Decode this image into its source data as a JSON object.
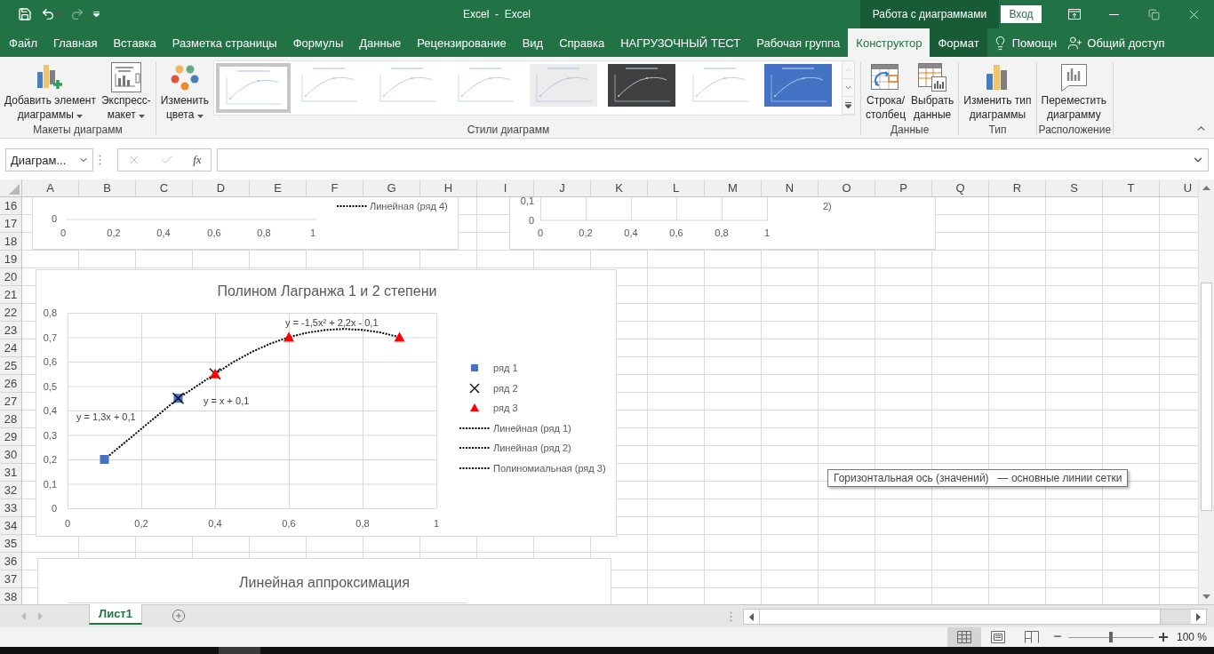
{
  "title_bar": {
    "title": "Excel  -  Excel",
    "context_label": "Работа с диаграммами",
    "sign_in": "Вход"
  },
  "tabs": [
    {
      "label": "Файл",
      "kind": "normal",
      "selected": false
    },
    {
      "label": "Главная",
      "kind": "normal",
      "selected": false
    },
    {
      "label": "Вставка",
      "kind": "normal",
      "selected": false
    },
    {
      "label": "Разметка страницы",
      "kind": "normal",
      "selected": false
    },
    {
      "label": "Формулы",
      "kind": "normal",
      "selected": false
    },
    {
      "label": "Данные",
      "kind": "normal",
      "selected": false
    },
    {
      "label": "Рецензирование",
      "kind": "normal",
      "selected": false
    },
    {
      "label": "Вид",
      "kind": "normal",
      "selected": false
    },
    {
      "label": "Справка",
      "kind": "normal",
      "selected": false
    },
    {
      "label": "НАГРУЗОЧНЫЙ ТЕСТ",
      "kind": "normal",
      "selected": false
    },
    {
      "label": "Рабочая группа",
      "kind": "normal",
      "selected": false
    },
    {
      "label": "Конструктор",
      "kind": "context",
      "selected": true
    },
    {
      "label": "Формат",
      "kind": "context",
      "selected": false
    }
  ],
  "tell_me": "Помощн",
  "share": "Общий доступ",
  "ribbon": {
    "groups": [
      {
        "label": "Макеты диаграмм",
        "items": [
          {
            "kind": "button",
            "lines": [
              "Добавить элемент",
              "диаграммы"
            ],
            "menu": true
          },
          {
            "kind": "button",
            "lines": [
              "Экспресс-",
              "макет"
            ],
            "menu": true
          }
        ]
      },
      {
        "label": "Стили диаграмм",
        "items": [
          {
            "kind": "button",
            "lines": [
              "Изменить",
              "цвета"
            ],
            "menu": true
          },
          {
            "kind": "gallery",
            "styles": [
              {
                "selected": true
              },
              {
                "selected": false
              },
              {
                "selected": false
              },
              {
                "selected": false
              },
              {
                "selected": false
              },
              {
                "selected": false
              },
              {
                "selected": false
              },
              {
                "selected": false
              }
            ]
          }
        ]
      },
      {
        "label": "Данные",
        "items": [
          {
            "kind": "button",
            "lines": [
              "Строка/",
              "столбец"
            ],
            "menu": false
          },
          {
            "kind": "button",
            "lines": [
              "Выбрать",
              "данные"
            ],
            "menu": false
          }
        ]
      },
      {
        "label": "Тип",
        "items": [
          {
            "kind": "button",
            "lines": [
              "Изменить тип",
              "диаграммы"
            ],
            "menu": false
          }
        ]
      },
      {
        "label": "Расположение",
        "items": [
          {
            "kind": "button",
            "lines": [
              "Переместить",
              "диаграмму"
            ],
            "menu": false
          }
        ]
      }
    ]
  },
  "formula_bar": {
    "name_box": "Диаграм...",
    "function_label": "fx"
  },
  "columns": [
    "A",
    "B",
    "C",
    "D",
    "E",
    "F",
    "G",
    "H",
    "I",
    "J",
    "K",
    "L",
    "M",
    "N",
    "O",
    "P",
    "Q",
    "R",
    "S",
    "T",
    "U"
  ],
  "rows": [
    "16",
    "17",
    "18",
    "19",
    "20",
    "21",
    "22",
    "23",
    "24",
    "25",
    "26",
    "27",
    "28",
    "29",
    "30",
    "31",
    "32",
    "33",
    "34",
    "35",
    "36",
    "37",
    "38"
  ],
  "upper_charts": [
    {
      "y_labels": [
        "0"
      ],
      "x_labels": [
        "0",
        "0,2",
        "0,4",
        "0,6",
        "0,8",
        "1"
      ],
      "legend": [
        {
          "text": "Линейная (ряд 4)",
          "line": true
        }
      ]
    },
    {
      "y_labels": [
        "0,1",
        "0"
      ],
      "x_labels": [
        "0",
        "0,2",
        "0,4",
        "0,6",
        "0,8",
        "1"
      ],
      "legend": [
        {
          "text": "2)",
          "line": false
        }
      ]
    }
  ],
  "main_chart": {
    "chart_data": {
      "type": "scatter",
      "title": "Полином Лагранжа 1 и 2 степени",
      "x": [
        0.1,
        0.3,
        0.4,
        0.45,
        0.5,
        0.55,
        0.6,
        0.65,
        0.7,
        0.75,
        0.8,
        0.85,
        0.9
      ],
      "series": [
        {
          "name": "ряд 1",
          "type": "scatter",
          "marker": "square",
          "color": "#4472c4",
          "values": [
            0.2,
            0.45,
            null,
            null,
            null,
            null,
            null,
            null,
            null,
            null,
            null,
            null,
            null
          ]
        },
        {
          "name": "ряд 2",
          "type": "scatter",
          "marker": "cross",
          "color": "#000000",
          "values": [
            null,
            0.45,
            0.55,
            null,
            null,
            null,
            null,
            null,
            null,
            null,
            null,
            null,
            null
          ]
        },
        {
          "name": "ряд 3",
          "type": "scatter",
          "marker": "triangle",
          "color": "#ff0000",
          "values": [
            null,
            null,
            0.55,
            null,
            null,
            null,
            0.7,
            null,
            null,
            null,
            null,
            null,
            0.7
          ]
        },
        {
          "name": "Линейная (ряд 1)",
          "type": "line",
          "line_style": "dotted",
          "color": "#000000",
          "values": [
            0.2,
            0.45,
            null,
            null,
            null,
            null,
            null,
            null,
            null,
            null,
            null,
            null,
            null
          ]
        },
        {
          "name": "Линейная (ряд 2)",
          "type": "line",
          "line_style": "dotted",
          "color": "#000000",
          "values": [
            null,
            0.45,
            0.55,
            null,
            null,
            null,
            null,
            null,
            null,
            null,
            null,
            null,
            null
          ]
        },
        {
          "name": "Полиномиальная (ряд 3)",
          "type": "line",
          "line_style": "dotted",
          "color": "#000000",
          "values": [
            null,
            null,
            0.55,
            0.599,
            0.64,
            0.674,
            0.7,
            0.719,
            0.73,
            0.734,
            0.73,
            0.719,
            0.7
          ]
        }
      ],
      "xlim": [
        0,
        1
      ],
      "ylim": [
        0,
        0.8
      ],
      "xticks": [
        {
          "value": 0,
          "label": "0"
        },
        {
          "value": 0.2,
          "label": "0,2"
        },
        {
          "value": 0.4,
          "label": "0,4"
        },
        {
          "value": 0.6,
          "label": "0,6"
        },
        {
          "value": 0.8,
          "label": "0,8"
        },
        {
          "value": 1,
          "label": "1"
        }
      ],
      "yticks": [
        {
          "value": 0,
          "label": "0"
        },
        {
          "value": 0.1,
          "label": "0,1"
        },
        {
          "value": 0.2,
          "label": "0,2"
        },
        {
          "value": 0.3,
          "label": "0,3"
        },
        {
          "value": 0.4,
          "label": "0,4"
        },
        {
          "value": 0.5,
          "label": "0,5"
        },
        {
          "value": 0.6,
          "label": "0,6"
        },
        {
          "value": 0.7,
          "label": "0,7"
        },
        {
          "value": 0.8,
          "label": "0,8"
        }
      ],
      "grid": true,
      "legend": "right",
      "annotations": [
        "y = 1,3x + 0,1",
        "y = x + 0,1",
        "y = -1,5x² + 2,2x - 0,1"
      ]
    }
  },
  "lower_chart": {
    "title": "Линейная аппроксимация"
  },
  "tooltip": "Горизонтальная ось (значений)   — основные линии сетки",
  "sheet_tabs": [
    {
      "label": "Лист1",
      "selected": true
    }
  ],
  "status_bar": {
    "views": [
      {
        "kind": "normal",
        "selected": true
      },
      {
        "kind": "page-layout",
        "selected": false
      },
      {
        "kind": "page-break",
        "selected": false
      }
    ],
    "zoom": {
      "level": 0.5,
      "label": "100 %"
    }
  }
}
